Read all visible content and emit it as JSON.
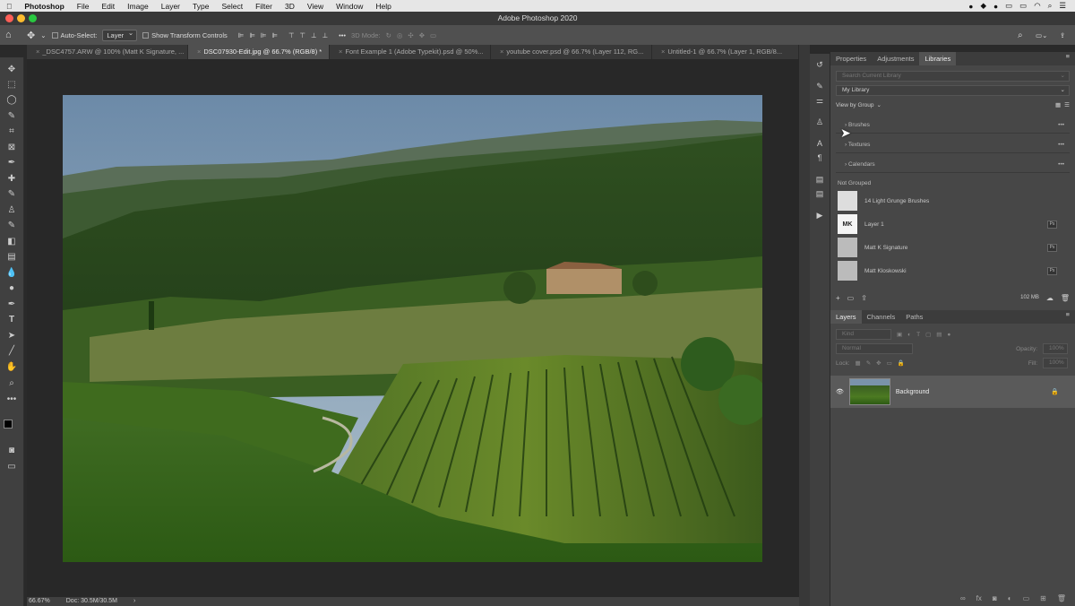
{
  "menubar": {
    "app": "Photoshop",
    "items": [
      "File",
      "Edit",
      "Image",
      "Layer",
      "Type",
      "Select",
      "Filter",
      "3D",
      "View",
      "Window",
      "Help"
    ]
  },
  "window": {
    "title": "Adobe Photoshop 2020"
  },
  "options": {
    "auto_select_label": "Auto-Select:",
    "auto_select_value": "Layer",
    "transform_label": "Show Transform Controls",
    "mode_3d": "3D Mode:"
  },
  "tabs": [
    {
      "label": "_DSC4757.ARW @ 100% (Matt K Signature, ..."
    },
    {
      "label": "DSC07930-Edit.jpg @ 66.7% (RGB/8) *"
    },
    {
      "label": "Font Example 1 (Adobe Typekit).psd @ 50%..."
    },
    {
      "label": "youtube cover.psd @ 66.7% (Layer 112, RG..."
    },
    {
      "label": "Untitled-1 @ 66.7% (Layer 1, RGB/8..."
    }
  ],
  "status": {
    "zoom": "66.67%",
    "doc": "Doc: 30.5M/30.5M"
  },
  "libraries": {
    "tabs": [
      "Properties",
      "Adjustments",
      "Libraries"
    ],
    "search_placeholder": "Search Current Library",
    "library": "My Library",
    "view": "View by Group",
    "groups": [
      "Brushes",
      "Textures",
      "Calendars"
    ],
    "not_grouped": "Not Grouped",
    "items": [
      "14 Light Grunge Brushes",
      "Layer 1",
      "Matt K Signature",
      "Matt Kloskowski"
    ],
    "thumb_text": "MK",
    "storage": "102 MB"
  },
  "layers": {
    "tabs": [
      "Layers",
      "Channels",
      "Paths"
    ],
    "kind": "Kind",
    "blend": "Normal",
    "opacity_label": "Opacity:",
    "opacity": "100%",
    "lock_label": "Lock:",
    "fill_label": "Fill:",
    "fill": "100%",
    "layer_name": "Background"
  },
  "colors": {
    "accent": "#3478f6",
    "panel": "#474747"
  }
}
